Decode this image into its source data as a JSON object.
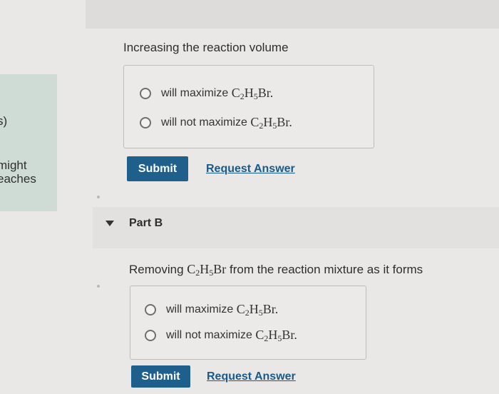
{
  "partA": {
    "question": "Increasing the reaction volume",
    "options": [
      {
        "text": "will maximize",
        "formula": {
          "c": "C",
          "c_sub": "2",
          "h": "H",
          "h_sub": "5",
          "tail": "Br."
        }
      },
      {
        "text": "will not maximize",
        "formula": {
          "c": "C",
          "c_sub": "2",
          "h": "H",
          "h_sub": "5",
          "tail": "Br."
        }
      }
    ],
    "submit_label": "Submit",
    "request_label": "Request Answer"
  },
  "sidebar": {
    "fragment_1": "s)",
    "fragment_2": "might",
    "fragment_3": "eaches"
  },
  "partB": {
    "label": "Part B",
    "question_prefix": "Removing",
    "question_formula": {
      "c": "C",
      "c_sub": "2",
      "h": "H",
      "h_sub": "5",
      "tail": "Br"
    },
    "question_suffix": "from the reaction mixture as it forms",
    "options": [
      {
        "text": "will maximize",
        "formula": {
          "c": "C",
          "c_sub": "2",
          "h": "H",
          "h_sub": "5",
          "tail": "Br."
        }
      },
      {
        "text": "will not maximize",
        "formula": {
          "c": "C",
          "c_sub": "2",
          "h": "H",
          "h_sub": "5",
          "tail": "Br."
        }
      }
    ],
    "submit_label": "Submit",
    "request_label": "Request Answer"
  },
  "colors": {
    "submit_bg": "#1f5f8b",
    "link": "#1a5a8a",
    "sidebar_panel": "#cfdcd6"
  }
}
